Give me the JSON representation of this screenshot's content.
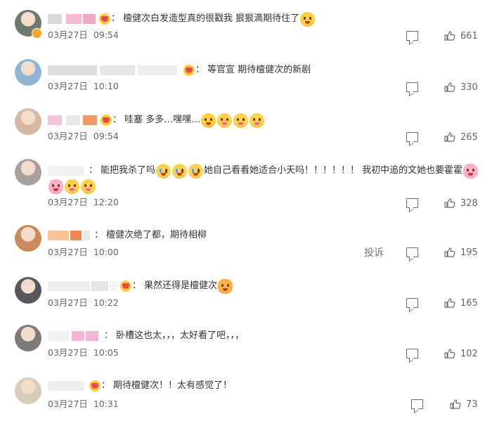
{
  "comments": [
    {
      "username": "",
      "avatar_color": "#6c7a6e",
      "verified_badge": true,
      "fan_badge_icon": "fan-heart-icon",
      "text_parts": [
        {
          "type": "text",
          "value": "檀健次白发造型真的很戳我 狠狠滴期待住了"
        },
        {
          "type": "emoji",
          "icon": "grinning-emoji-icon"
        }
      ],
      "date": "03月27日",
      "time": "09:54",
      "likes": "661",
      "report_label": ""
    },
    {
      "username": "",
      "avatar_color": "#8fb4d6",
      "verified_badge": false,
      "fan_badge_icon": "fan-heart-icon",
      "text_parts": [
        {
          "type": "text",
          "value": "等官宣 期待檀健次的新剧"
        }
      ],
      "date": "03月27日",
      "time": "10:10",
      "likes": "330",
      "report_label": ""
    },
    {
      "username": "",
      "avatar_color": "#d9b8a2",
      "verified_badge": false,
      "fan_badge_icon": "fan-heart-icon",
      "text_parts": [
        {
          "type": "text",
          "value": "哇塞 多多…嘿嘿…"
        },
        {
          "type": "emoji",
          "icon": "grinning-emoji-icon"
        },
        {
          "type": "emoji",
          "icon": "party-emoji-icon"
        },
        {
          "type": "emoji",
          "icon": "party-emoji-icon"
        },
        {
          "type": "emoji",
          "icon": "party-emoji-icon"
        }
      ],
      "date": "03月27日",
      "time": "09:54",
      "likes": "265",
      "report_label": ""
    },
    {
      "username": "",
      "avatar_color": "#a7a1a0",
      "verified_badge": false,
      "fan_badge_icon": "",
      "text_parts": [
        {
          "type": "text",
          "value": "能把我杀了吗"
        },
        {
          "type": "emoji",
          "icon": "crying-emoji-icon"
        },
        {
          "type": "emoji",
          "icon": "crying-emoji-icon"
        },
        {
          "type": "emoji",
          "icon": "crying-emoji-icon"
        },
        {
          "type": "text",
          "value": "她自己看看她适合小夭吗！！！！！！ 我初中追的文她也要霍霍"
        },
        {
          "type": "emoji",
          "icon": "flower-emoji-icon"
        }
      ],
      "text_parts_line2": [
        {
          "type": "emoji",
          "icon": "flower-emoji-icon"
        },
        {
          "type": "emoji",
          "icon": "party-emoji-icon"
        },
        {
          "type": "emoji",
          "icon": "party-emoji-icon"
        }
      ],
      "date": "03月27日",
      "time": "12:20",
      "likes": "328",
      "report_label": ""
    },
    {
      "username": "",
      "avatar_color": "#c98b5c",
      "verified_badge": false,
      "fan_badge_icon": "",
      "text_parts": [
        {
          "type": "text",
          "value": "檀健次绝了都，期待相柳"
        }
      ],
      "date": "03月27日",
      "time": "10:00",
      "likes": "195",
      "report_label": "投诉"
    },
    {
      "username": "",
      "avatar_color": "#55595c",
      "verified_badge": false,
      "fan_badge_icon": "fan-heart-icon",
      "text_parts": [
        {
          "type": "text",
          "value": "果然还得是檀健次"
        },
        {
          "type": "emoji",
          "icon": "fist-emoji-icon"
        }
      ],
      "date": "03月27日",
      "time": "10:22",
      "likes": "165",
      "report_label": ""
    },
    {
      "username": "",
      "avatar_color": "#7f7b78",
      "verified_badge": false,
      "fan_badge_icon": "",
      "text_parts": [
        {
          "type": "text",
          "value": "卧槽这也太，，，太好看了吧，，，"
        }
      ],
      "date": "03月27日",
      "time": "10:05",
      "likes": "102",
      "report_label": ""
    },
    {
      "username": "",
      "avatar_color": "#d7ccb9",
      "verified_badge": false,
      "fan_badge_icon": "fan-heart-icon",
      "text_parts": [
        {
          "type": "text",
          "value": "期待檀健次！！太有感觉了！"
        }
      ],
      "date": "03月27日",
      "time": "10:31",
      "likes": "73",
      "report_label": ""
    }
  ],
  "colors": {
    "text": "#333333",
    "meta": "#666666",
    "icon": "#6a6a6a",
    "badge_orange": "#f5a623"
  },
  "icons": {
    "reply": "comment-reply-icon",
    "like": "thumbs-up-icon"
  }
}
